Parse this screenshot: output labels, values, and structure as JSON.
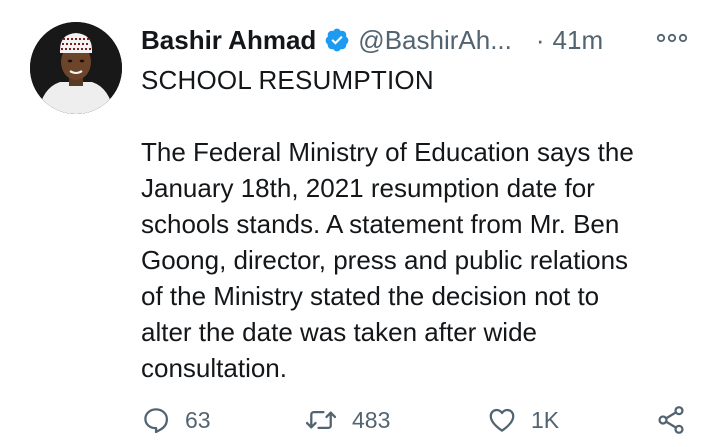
{
  "author": {
    "name": "Bashir Ahmad",
    "handle": "@BashirAh...",
    "separator": "·",
    "time": "41m"
  },
  "tweet": {
    "title": "SCHOOL RESUMPTION",
    "body_lines": [
      "The Federal Ministry of Education says the",
      "January 18th, 2021 resumption date for",
      "schools stands. A statement from Mr. Ben",
      "Goong, director, press and public relations",
      "of the Ministry stated the decision not to",
      "alter the date was taken after wide",
      "consultation."
    ]
  },
  "actions": {
    "reply_count": "63",
    "retweet_count": "483",
    "like_count": "1K"
  },
  "icons": {
    "verified": "verified-badge-icon",
    "more": "more-options-icon",
    "reply": "reply-icon",
    "retweet": "retweet-icon",
    "like": "heart-icon",
    "share": "share-icon"
  },
  "colors": {
    "text": "#14171a",
    "secondary": "#536471",
    "verified": "#1d9bf0"
  }
}
